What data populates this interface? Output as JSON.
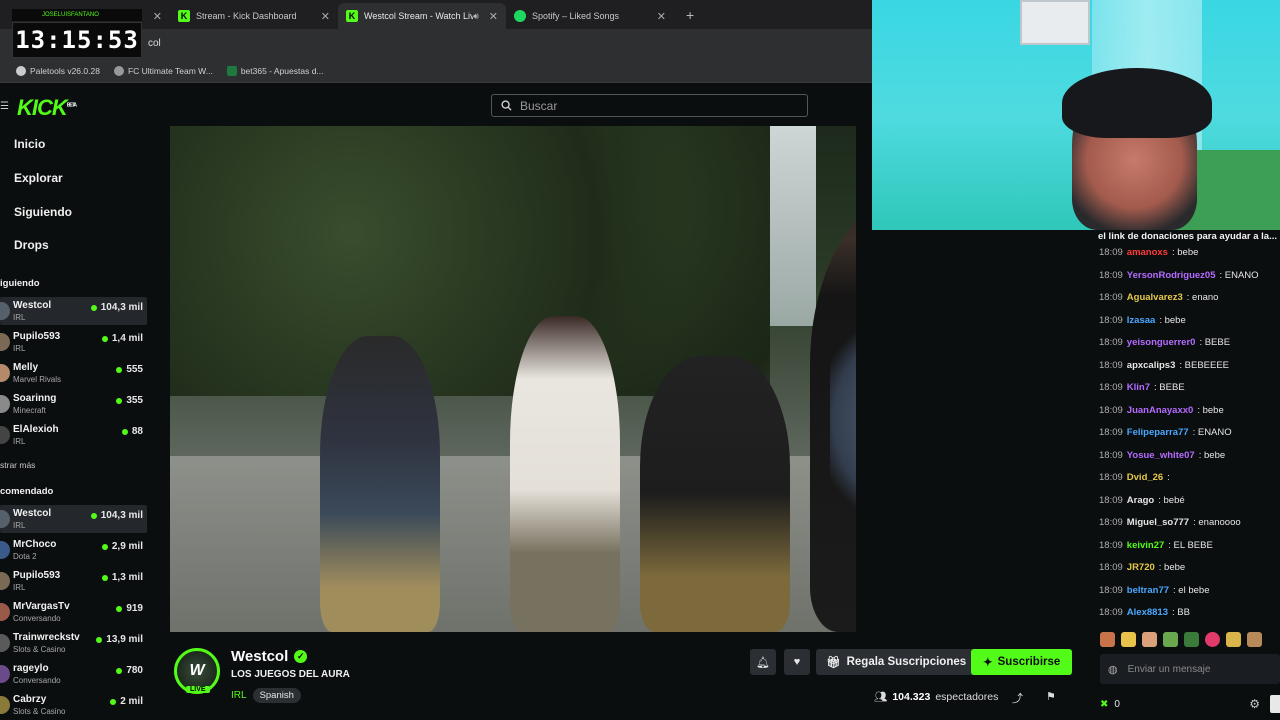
{
  "clock": {
    "time": "13:15:53",
    "top": "JOSELUISFANTANO"
  },
  "tabs": [
    {
      "title": "",
      "favicon_color": "#ffffff"
    },
    {
      "title": "Stream - Kick Dashboard",
      "favicon_color": "#53fc18"
    },
    {
      "title": "Westcol Stream - Watch Live",
      "favicon_color": "#53fc18"
    },
    {
      "title": "Spotify – Liked Songs",
      "favicon_color": "#1ed760"
    }
  ],
  "url_fragment": "col",
  "bookmarks": [
    "Paletools v26.0.28",
    "FC Ultimate Team W...",
    "bet365 - Apuestas d..."
  ],
  "kick": {
    "logo": "KICK",
    "beta": "BETA",
    "search_placeholder": "Buscar",
    "accent": "#53fc18"
  },
  "nav": {
    "inicio": "Inicio",
    "explorar": "Explorar",
    "siguiendo": "Siguiendo",
    "drops": "Drops"
  },
  "following": {
    "heading": "iguiendo",
    "channels": [
      {
        "name": "Westcol",
        "category": "IRL",
        "viewers": "104,3 mil"
      },
      {
        "name": "Pupilo593",
        "category": "IRL",
        "viewers": "1,4 mil"
      },
      {
        "name": "Melly",
        "category": "Marvel Rivals",
        "viewers": "555"
      },
      {
        "name": "Soarinng",
        "category": "Minecraft",
        "viewers": "355"
      },
      {
        "name": "ElAlexioh",
        "category": "IRL",
        "viewers": "88"
      }
    ],
    "more": "strar más"
  },
  "recommended": {
    "heading": "comendado",
    "channels": [
      {
        "name": "Westcol",
        "category": "IRL",
        "viewers": "104,3 mil"
      },
      {
        "name": "MrChoco",
        "category": "Dota 2",
        "viewers": "2,9 mil"
      },
      {
        "name": "Pupilo593",
        "category": "IRL",
        "viewers": "1,3 mil"
      },
      {
        "name": "MrVargasTv",
        "category": "Conversando",
        "viewers": "919"
      },
      {
        "name": "Trainwreckstv",
        "category": "Slots & Casino",
        "viewers": "13,9 mil"
      },
      {
        "name": "rageylo",
        "category": "Conversando",
        "viewers": "780"
      },
      {
        "name": "Cabrzy",
        "category": "Slots & Casino",
        "viewers": "2 mil"
      }
    ]
  },
  "chat": {
    "pinned": "el link de donaciones para ayudar a la...",
    "messages": [
      {
        "time": "18:09",
        "user": "amanoxs",
        "text": ": bebe",
        "color": "#ff3b3b"
      },
      {
        "time": "18:09",
        "user": "YersonRodriguez05",
        "text": ": ENANO",
        "color": "#b66bff"
      },
      {
        "time": "18:09",
        "user": "Agualvarez3",
        "text": ": enano",
        "color": "#e5c84a"
      },
      {
        "time": "18:09",
        "user": "Izasaa",
        "text": ": bebe",
        "color": "#4aa8ff"
      },
      {
        "time": "18:09",
        "user": "yeisonguerrer0",
        "text": ": BEBE",
        "color": "#b66bff"
      },
      {
        "time": "18:09",
        "user": "apxcalips3",
        "text": ": BEBEEEE",
        "color": "#e6e6e6"
      },
      {
        "time": "18:09",
        "user": "Klin7",
        "text": ": BEBE",
        "color": "#b66bff"
      },
      {
        "time": "18:09",
        "user": "JuanAnayaxx0",
        "text": ": bebe",
        "color": "#b66bff"
      },
      {
        "time": "18:09",
        "user": "Felipeparra77",
        "text": ": ENANO",
        "color": "#4aa8ff"
      },
      {
        "time": "18:09",
        "user": "Yosue_white07",
        "text": ": bebe",
        "color": "#b66bff"
      },
      {
        "time": "18:09",
        "user": "Dvid_26",
        "text": ":",
        "color": "#e5c84a"
      },
      {
        "time": "18:09",
        "user": "Arago",
        "text": ": bebé",
        "color": "#e6e6e6"
      },
      {
        "time": "18:09",
        "user": "Miguel_so777",
        "text": ": enanoooo",
        "color": "#e6e6e6"
      },
      {
        "time": "18:09",
        "user": "keivin27",
        "text": ": EL BEBE",
        "color": "#53fc18"
      },
      {
        "time": "18:09",
        "user": "JR720",
        "text": ": bebe",
        "color": "#e5c84a"
      },
      {
        "time": "18:09",
        "user": "beltran77",
        "text": ": el bebe",
        "color": "#4aa8ff"
      },
      {
        "time": "18:09",
        "user": "Alex8813",
        "text": ": BB",
        "color": "#4aa8ff"
      }
    ],
    "input_placeholder": "Enviar un mensaje",
    "points": "0"
  },
  "stream": {
    "name": "Westcol",
    "title": "LOS JUEGOS DEL AURA",
    "category": "IRL",
    "language": "Spanish",
    "live": "LIVE",
    "avatar_letter": "W",
    "gift_label": "Regala Suscripciones",
    "subscribe_label": "Suscribirse",
    "viewers": "104.323",
    "viewers_label": "espectadores"
  }
}
